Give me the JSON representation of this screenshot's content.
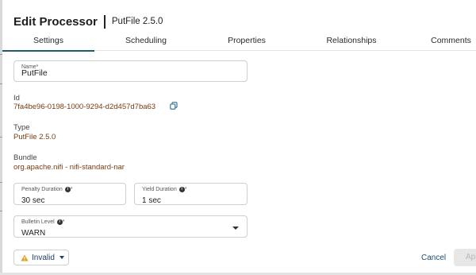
{
  "dialog": {
    "title": "Edit Processor",
    "subtitle": "PutFile 2.5.0"
  },
  "tabs": [
    {
      "label": "Settings",
      "active": true
    },
    {
      "label": "Scheduling",
      "active": false
    },
    {
      "label": "Properties",
      "active": false
    },
    {
      "label": "Relationships",
      "active": false
    },
    {
      "label": "Comments",
      "active": false
    }
  ],
  "settings": {
    "name": {
      "label": "Name*",
      "value": "PutFile"
    },
    "id": {
      "label": "Id",
      "value": "7fa4be96-0198-1000-9294-d2d457d7ba63"
    },
    "type": {
      "label": "Type",
      "value": "PutFile 2.5.0"
    },
    "bundle": {
      "label": "Bundle",
      "value": "org.apache.nifi - nifi-standard-nar"
    },
    "penalty_duration": {
      "label": "Penalty Duration",
      "required_mark": "*",
      "value": "30 sec"
    },
    "yield_duration": {
      "label": "Yield Duration",
      "required_mark": "*",
      "value": "1 sec"
    },
    "bulletin_level": {
      "label": "Bulletin Level",
      "required_mark": "*",
      "value": "WARN"
    }
  },
  "footer": {
    "status_label": "Invalid",
    "cancel_label": "Cancel",
    "apply_label": "App"
  },
  "icons": {
    "copy": "copy-icon",
    "info": "info-icon",
    "warning": "warning-icon",
    "dropdown": "chevron-down-icon"
  },
  "colors": {
    "accent": "#205a6e",
    "value_text": "#7a3b12",
    "warning": "#e0a21a",
    "link": "#1f4a6a"
  }
}
